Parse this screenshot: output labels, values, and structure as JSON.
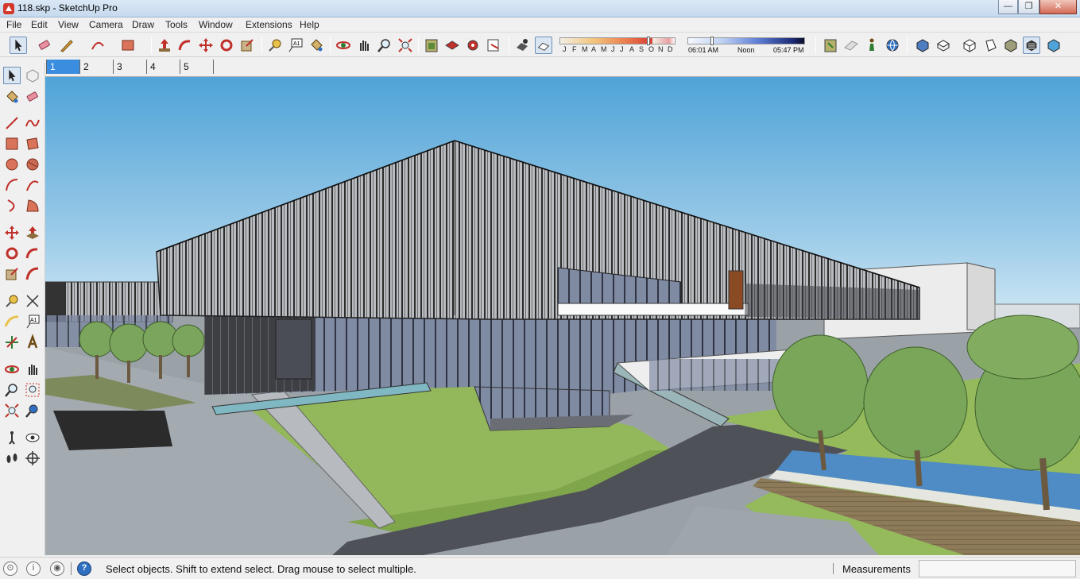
{
  "window": {
    "title": "118.skp - SketchUp Pro",
    "controls": [
      "—",
      "❐",
      "✕"
    ]
  },
  "menu": [
    "File",
    "Edit",
    "View",
    "Camera",
    "Draw",
    "Tools",
    "Window",
    "Extensions",
    "Help"
  ],
  "toolbar_icons": [
    "select-icon",
    "eraser-icon",
    "pencil-icon",
    "arc-icon",
    "rectangle-icon",
    "push-pull-icon",
    "follow-me-icon",
    "move-icon",
    "rotate-icon",
    "scale-icon",
    "tape-measure-icon",
    "text-icon",
    "paint-bucket-icon",
    "orbit-icon",
    "pan-icon",
    "zoom-icon",
    "zoom-extents-icon",
    "warehouse-icon",
    "components-icon",
    "extension-warehouse-icon",
    "send-to-layout-icon",
    "shadows-icon",
    "fog-icon",
    "add-location-icon",
    "section-plane-icon",
    "person-icon",
    "geo-icon",
    "iso-view-icon",
    "top-view-icon",
    "front-view-icon",
    "right-view-icon",
    "back-view-icon",
    "left-view-icon",
    "xray-icon"
  ],
  "shadow_settings": {
    "months": [
      "J",
      "F",
      "M",
      "A",
      "M",
      "J",
      "J",
      "A",
      "S",
      "O",
      "N",
      "D"
    ],
    "sunrise": "06:01 AM",
    "noon": "Noon",
    "sunset": "05:47 PM",
    "month_fraction": 0.8,
    "time_fraction": 0.2
  },
  "scene_tabs": [
    "1",
    "2",
    "3",
    "4",
    "5"
  ],
  "active_scene": "1",
  "status": {
    "message": "Select objects. Shift to extend select. Drag mouse to select multiple.",
    "measurements_label": "Measurements",
    "measurements_value": ""
  },
  "colors": {
    "sky_top": "#4fa3d8",
    "sky_bottom": "#dbeef7",
    "grass": "#8fb85a",
    "accent": "#3b8de0"
  }
}
